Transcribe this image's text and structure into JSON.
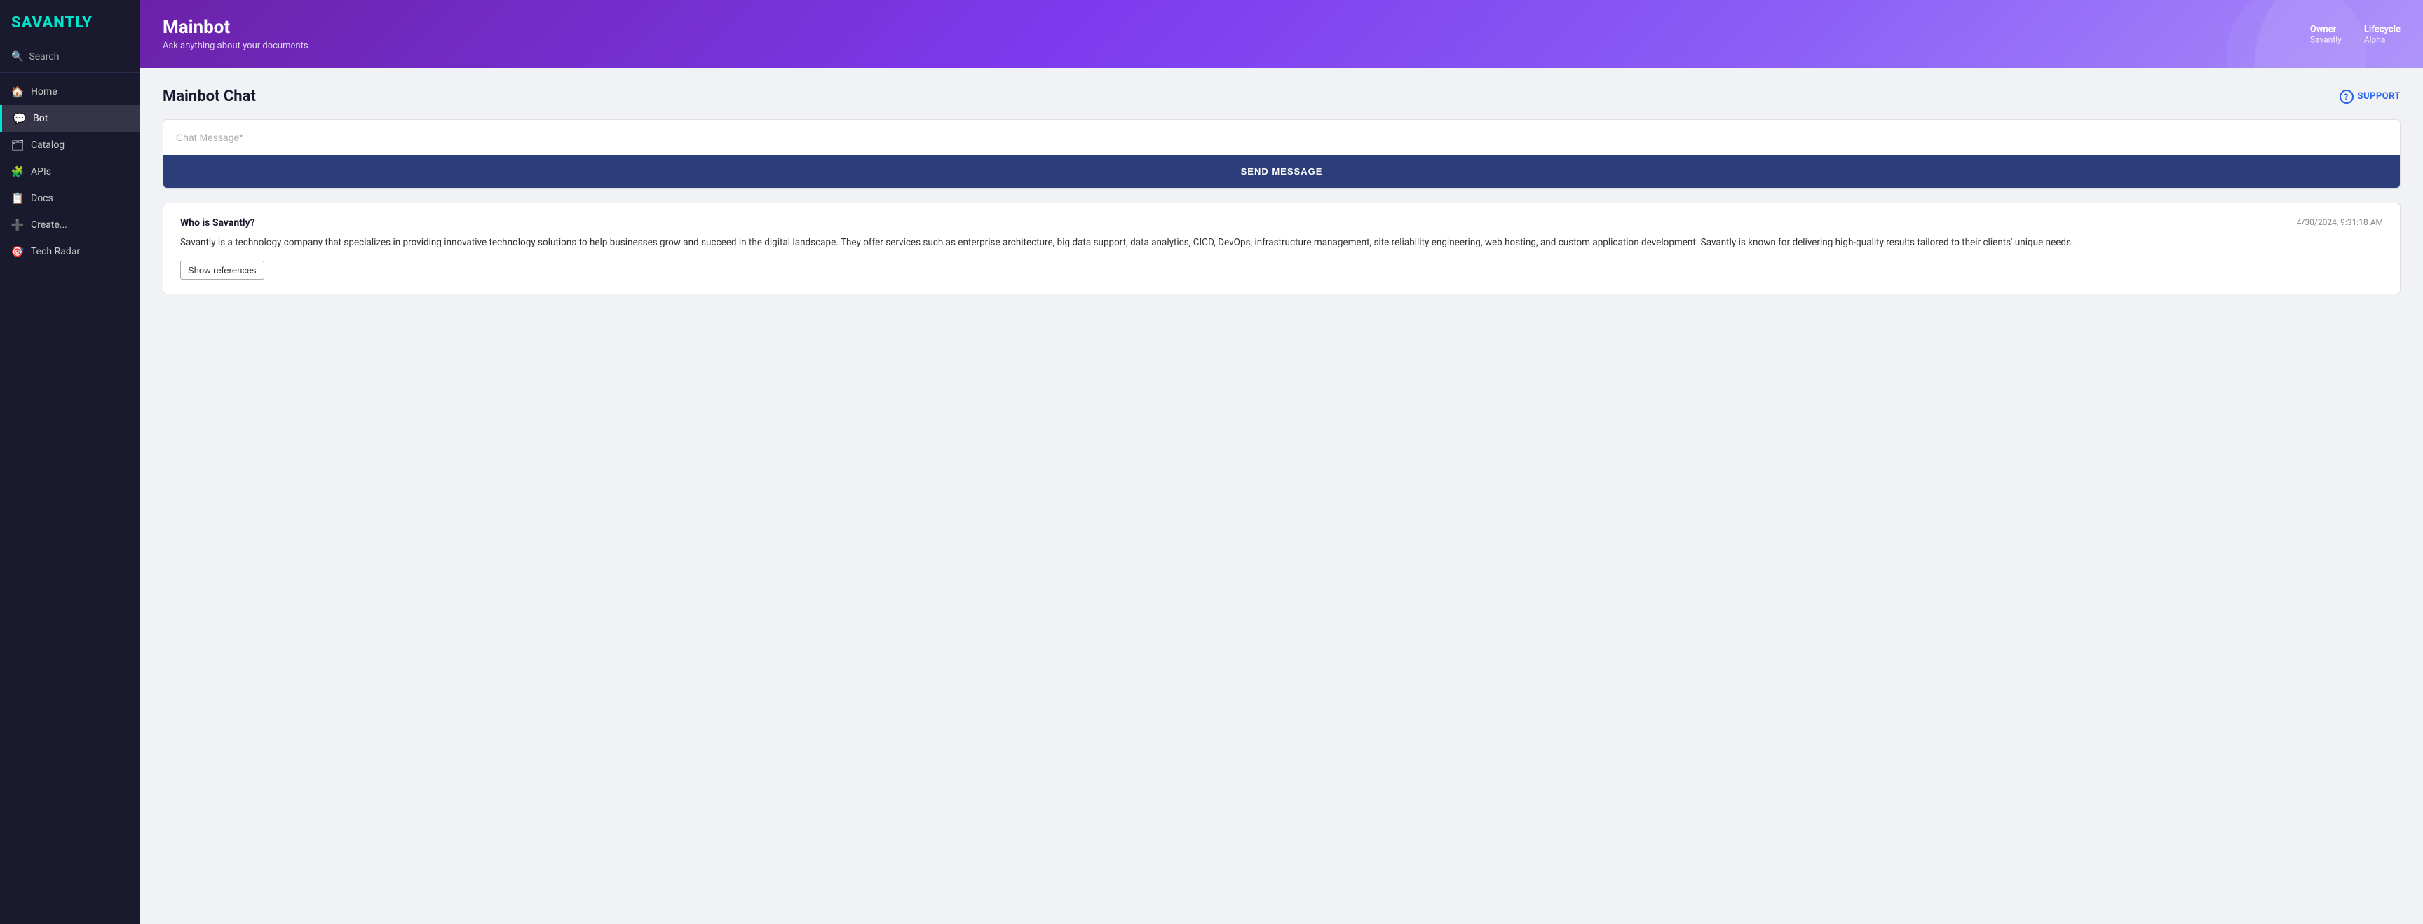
{
  "sidebar": {
    "logo": "SAVANTLY",
    "search_label": "Search",
    "nav_items": [
      {
        "id": "home",
        "label": "Home",
        "icon": "🏠",
        "active": false
      },
      {
        "id": "bot",
        "label": "Bot",
        "icon": "💬",
        "active": true
      },
      {
        "id": "catalog",
        "label": "Catalog",
        "icon": "🗂",
        "active": false
      },
      {
        "id": "apis",
        "label": "APIs",
        "icon": "🧩",
        "active": false
      },
      {
        "id": "docs",
        "label": "Docs",
        "icon": "📋",
        "active": false
      },
      {
        "id": "create",
        "label": "Create...",
        "icon": "➕",
        "active": false
      },
      {
        "id": "tech-radar",
        "label": "Tech Radar",
        "icon": "🎯",
        "active": false
      }
    ]
  },
  "header": {
    "title": "Mainbot",
    "subtitle": "Ask anything about your documents",
    "owner_label": "Owner",
    "owner_value": "Savantly",
    "lifecycle_label": "Lifecycle",
    "lifecycle_value": "Alpha"
  },
  "content": {
    "title": "Mainbot Chat",
    "support_label": "SUPPORT",
    "chat_input_placeholder": "Chat Message*",
    "send_button_label": "SEND MESSAGE",
    "messages": [
      {
        "question": "Who is Savantly?",
        "timestamp": "4/30/2024, 9:31:18 AM",
        "body": "Savantly is a technology company that specializes in providing innovative technology solutions to help businesses grow and succeed in the digital landscape. They offer services such as enterprise architecture, big data support, data analytics, CICD, DevOps, infrastructure management, site reliability engineering, web hosting, and custom application development. Savantly is known for delivering high-quality results tailored to their clients' unique needs.",
        "show_references_label": "Show references"
      }
    ]
  }
}
